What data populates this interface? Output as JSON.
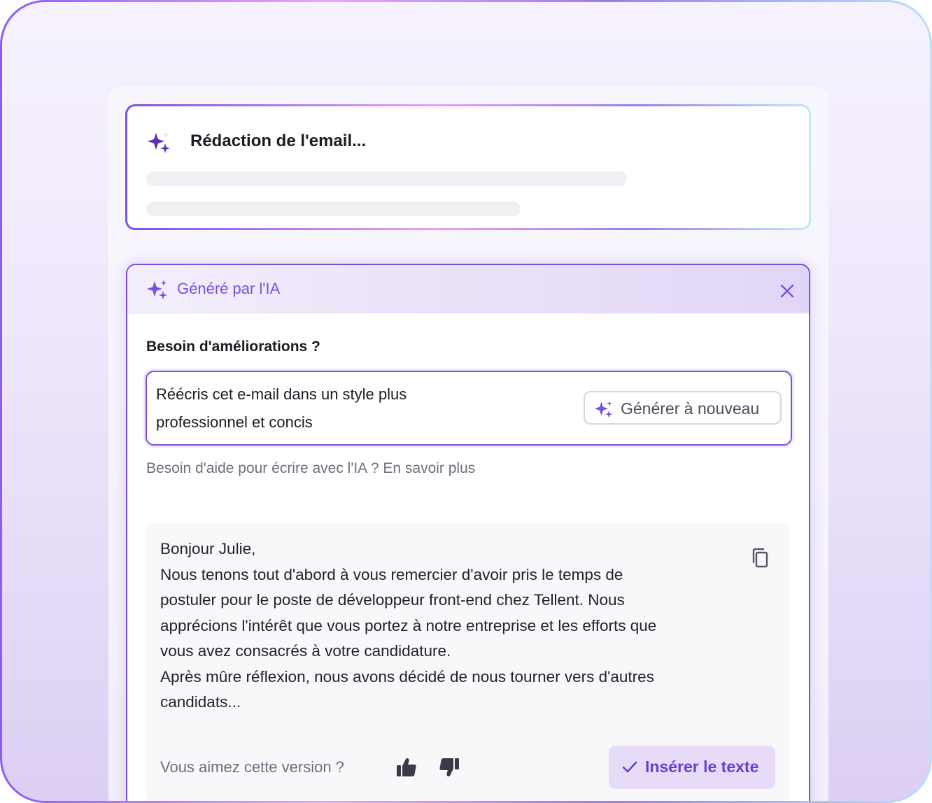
{
  "status_card": {
    "title": "Rédaction de l'email..."
  },
  "ai_panel": {
    "header": {
      "label": "Généré par l'IA",
      "close_icon": "close-icon"
    },
    "improvement": {
      "label": "Besoin d'améliorations ?",
      "prompt_line_1": "Réécris cet e-mail dans un style plus",
      "prompt_line_2": "professionnel et concis",
      "regenerate_label": "Générer à nouveau"
    },
    "help_text": "Besoin d'aide pour écrire avec l'IA ? En savoir plus",
    "result": {
      "lines": [
        "Bonjour Julie,",
        "Nous tenons tout d'abord à vous remercier d'avoir pris le temps de",
        "postuler pour le poste de développeur front-end chez Tellent. Nous",
        "apprécions l'intérêt que vous portez à notre entreprise et les efforts que",
        "vous avez consacrés à votre candidature.",
        "Après mûre réflexion, nous avons décidé de nous tourner vers d'autres",
        "candidats..."
      ],
      "copy_icon": "copy-icon",
      "feedback_label": "Vous aimez cette version ?",
      "thumbs_up_icon": "thumbs-up-icon",
      "thumbs_down_icon": "thumbs-down-icon",
      "insert_label": "Insérer le texte"
    }
  },
  "colors": {
    "accent": "#7a4fe0",
    "border_accent": "#7b4fd6",
    "insert_bg": "#e6dcf8",
    "text_dark": "#1b1b24",
    "text_muted": "#6e6e7e"
  }
}
